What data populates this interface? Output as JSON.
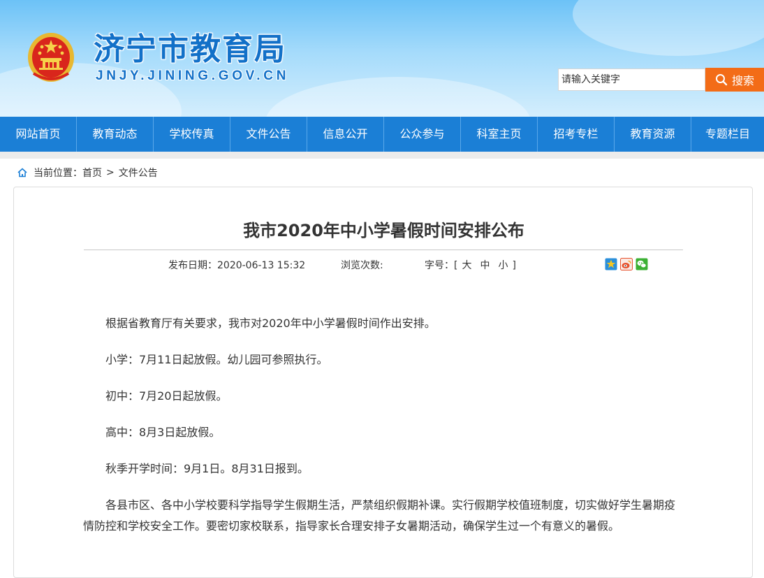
{
  "header": {
    "site_title": "济宁市教育局",
    "site_domain": "JNJY.JINING.GOV.CN",
    "search_placeholder": "请输入关键字",
    "search_button_label": "搜索"
  },
  "nav": {
    "items": [
      "网站首页",
      "教育动态",
      "学校传真",
      "文件公告",
      "信息公开",
      "公众参与",
      "科室主页",
      "招考专栏",
      "教育资源",
      "专题栏目"
    ]
  },
  "breadcrumb": {
    "label": "当前位置：",
    "home": "首页",
    "separator": ">",
    "current": "文件公告"
  },
  "article": {
    "title": "我市2020年中小学暑假时间安排公布",
    "date_label": "发布日期：",
    "date": "2020-06-13 15:32",
    "views_label": "浏览次数:",
    "views_value": "",
    "font_size_label": "字号：",
    "font_size_open": "[",
    "font_large": "大",
    "font_medium": "中",
    "font_small": "小",
    "font_size_close": "]",
    "paragraphs": [
      "根据省教育厅有关要求，我市对2020年中小学暑假时间作出安排。",
      "小学：7月11日起放假。幼儿园可参照执行。",
      "初中：7月20日起放假。",
      "高中：8月3日起放假。",
      "秋季开学时间：9月1日。8月31日报到。",
      "各县市区、各中小学校要科学指导学生假期生活，严禁组织假期补课。实行假期学校值班制度，切实做好学生暑期疫情防控和学校安全工作。要密切家校联系，指导家长合理安排子女暑期活动，确保学生过一个有意义的暑假。"
    ]
  },
  "share": {
    "icons": [
      "qzone-icon",
      "weibo-icon",
      "wechat-icon"
    ]
  },
  "colors": {
    "nav_bg": "#1b7fd6",
    "search_button": "#f36c17",
    "title_blue": "#1270c8"
  }
}
